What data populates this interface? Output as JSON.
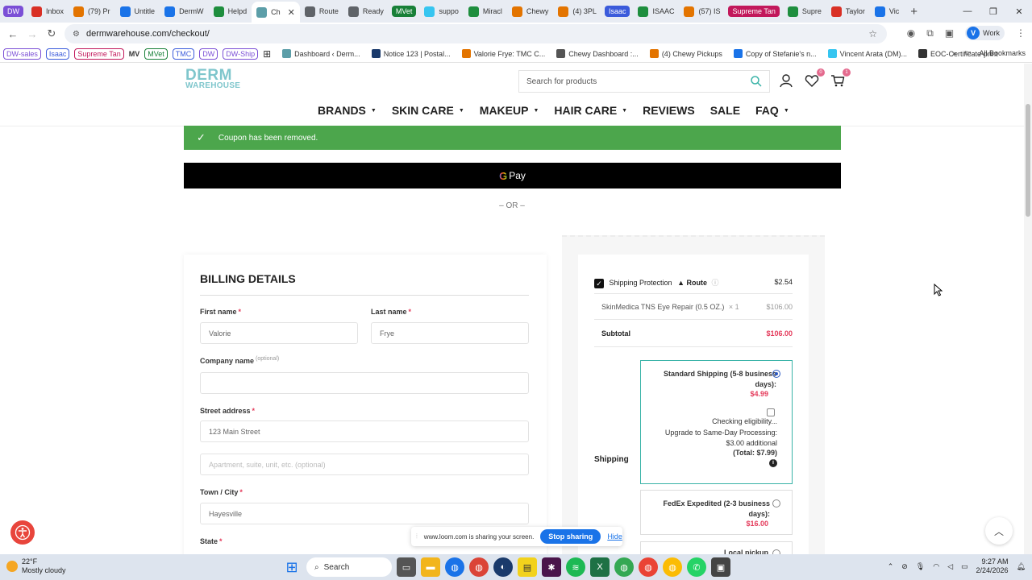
{
  "browser": {
    "tabs": [
      {
        "label": "DW",
        "color": "#7b4fd6",
        "pill": true
      },
      {
        "label": "Inbox",
        "color": "#d93025"
      },
      {
        "label": "(79) Pr",
        "color": "#e37400"
      },
      {
        "label": "Untitle",
        "color": "#1a73e8"
      },
      {
        "label": "DermW",
        "color": "#1a73e8"
      },
      {
        "label": "Helpd",
        "color": "#1e8e3e"
      },
      {
        "label": "Ch",
        "color": "#5c9ea8",
        "active": true
      },
      {
        "label": "Route",
        "color": "#5f6368"
      },
      {
        "label": "Ready",
        "color": "#5f6368"
      },
      {
        "label": "MVet",
        "color": "#188038",
        "pill": true
      },
      {
        "label": "suppo",
        "color": "#36c5f0"
      },
      {
        "label": "Miracl",
        "color": "#1e8e3e"
      },
      {
        "label": "Chewy",
        "color": "#e37400"
      },
      {
        "label": "(4) 3PL",
        "color": "#e37400"
      },
      {
        "label": "Isaac",
        "color": "#3b5bdb",
        "pill": true
      },
      {
        "label": "ISAAC",
        "color": "#1e8e3e"
      },
      {
        "label": "(57) IS",
        "color": "#e37400"
      },
      {
        "label": "Supreme Tan",
        "color": "#c2185b",
        "pill": true
      },
      {
        "label": "Supre",
        "color": "#1e8e3e"
      },
      {
        "label": "Taylor",
        "color": "#d93025"
      },
      {
        "label": "Vic",
        "color": "#1a73e8"
      }
    ],
    "url": "dermwarehouse.com/checkout/",
    "profile_initial": "V",
    "profile_label": "Work",
    "bookmark_chips": [
      {
        "label": "DW-sales",
        "color": "#7b4fd6"
      },
      {
        "label": "Isaac",
        "color": "#3b5bdb"
      },
      {
        "label": "Supreme Tan",
        "color": "#c2185b"
      },
      {
        "label": "MV",
        "color": "#333333",
        "plain": true
      },
      {
        "label": "MVet",
        "color": "#188038"
      },
      {
        "label": "TMC",
        "color": "#3b5bdb"
      },
      {
        "label": "DW",
        "color": "#7b4fd6"
      },
      {
        "label": "DW-Ship",
        "color": "#7b4fd6"
      }
    ],
    "bookmarks": [
      {
        "label": "Dashboard ‹ Derm...",
        "color": "#5c9ea8"
      },
      {
        "label": "Notice 123 | Postal...",
        "color": "#1a3a6b"
      },
      {
        "label": "Valorie Frye: TMC C...",
        "color": "#e37400"
      },
      {
        "label": "Chewy Dashboard :...",
        "color": "#555555"
      },
      {
        "label": "(4) Chewy Pickups",
        "color": "#e37400"
      },
      {
        "label": "Copy of Stefanie's n...",
        "color": "#1a73e8"
      },
      {
        "label": "Vincent Arata (DM)...",
        "color": "#36c5f0"
      },
      {
        "label": "EOC-Certificate-print",
        "color": "#333333"
      }
    ],
    "all_bookmarks": "All Bookmarks"
  },
  "site": {
    "logo_line1": "DERM",
    "logo_line2": "WAREHOUSE",
    "search_placeholder": "Search for products",
    "wishlist_count": "0",
    "cart_count": "1",
    "nav": [
      {
        "label": "BRANDS",
        "caret": true
      },
      {
        "label": "SKIN CARE",
        "caret": true
      },
      {
        "label": "MAKEUP",
        "caret": true
      },
      {
        "label": "HAIR CARE",
        "caret": true
      },
      {
        "label": "REVIEWS",
        "caret": false
      },
      {
        "label": "SALE",
        "caret": false
      },
      {
        "label": "FAQ",
        "caret": true
      }
    ]
  },
  "checkout": {
    "notice": "Coupon has been removed.",
    "gpay_label": "Pay",
    "or_text": "– OR –",
    "billing": {
      "title": "BILLING DETAILS",
      "first_name_label": "First name",
      "first_name_value": "Valorie",
      "last_name_label": "Last name",
      "last_name_value": "Frye",
      "company_label": "Company name",
      "company_optional": "(optional)",
      "street_label": "Street address",
      "street_value": "123 Main Street",
      "apt_placeholder": "Apartment, suite, unit, etc. (optional)",
      "city_label": "Town / City",
      "city_value": "Hayesville",
      "state_label": "State",
      "required_mark": "*"
    },
    "summary": {
      "protection_label": "Shipping Protection",
      "route_label": "Route",
      "protection_price": "$2.54",
      "item_name": "SkinMedica TNS Eye Repair (0.5 OZ.)",
      "item_qty": "× 1",
      "item_price": "$106.00",
      "subtotal_label": "Subtotal",
      "subtotal_value": "$106.00",
      "shipping_label": "Shipping",
      "standard_label": "Standard Shipping (5-8 business days):",
      "standard_price": "$4.99",
      "checking": "Checking eligibility...",
      "upgrade": "Upgrade to Same-Day Processing: $3.00 additional",
      "upgrade_total": "(Total: $7.99)",
      "fedex_label": "FedEx Expedited (2-3 business days):",
      "fedex_price": "$16.00",
      "pickup_label": "Local pickup"
    }
  },
  "overlays": {
    "share_text": "www.loom.com is sharing your screen.",
    "stop_sharing": "Stop sharing",
    "hide": "Hide"
  },
  "taskbar": {
    "temp": "22°F",
    "weather": "Mostly cloudy",
    "search": "Search",
    "time": "9:27 AM",
    "date": "2/24/2026",
    "notif_count": "3"
  },
  "colors": {
    "accent_teal": "#39b3a7",
    "price_red": "#e43b5b",
    "notice_green": "#4ca64c"
  }
}
